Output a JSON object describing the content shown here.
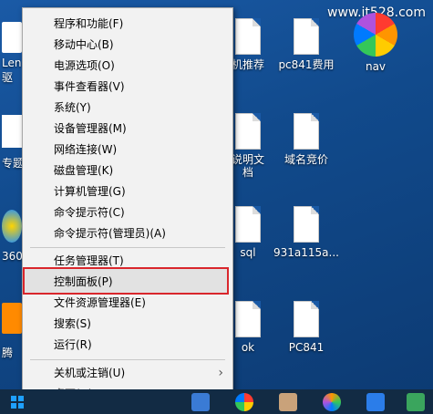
{
  "watermark": "www.it528.com",
  "desktop": {
    "icons": [
      {
        "label": "机推荐",
        "lines": [
          "机推荐"
        ]
      },
      {
        "label": "pc841费用",
        "lines": [
          "pc841费用"
        ]
      },
      {
        "label": "nav",
        "lines": [
          "nav"
        ]
      },
      {
        "label": "说明文档",
        "lines": [
          "说明文",
          "档"
        ]
      },
      {
        "label": "域名竞价",
        "lines": [
          "域名竞价"
        ]
      },
      {
        "label": "sql",
        "lines": [
          "sql"
        ]
      },
      {
        "label": "931a115a...",
        "lines": [
          "931a115a..."
        ]
      },
      {
        "label": "ok",
        "lines": [
          "ok"
        ]
      },
      {
        "label": "PC841",
        "lines": [
          "PC841"
        ]
      }
    ],
    "left_partial": [
      "Len",
      "驱",
      "专题",
      "360",
      "腾"
    ]
  },
  "menu": {
    "items": [
      {
        "label": "程序和功能(F)"
      },
      {
        "label": "移动中心(B)"
      },
      {
        "label": "电源选项(O)"
      },
      {
        "label": "事件查看器(V)"
      },
      {
        "label": "系统(Y)"
      },
      {
        "label": "设备管理器(M)"
      },
      {
        "label": "网络连接(W)"
      },
      {
        "label": "磁盘管理(K)"
      },
      {
        "label": "计算机管理(G)"
      },
      {
        "label": "命令提示符(C)"
      },
      {
        "label": "命令提示符(管理员)(A)"
      },
      {
        "label": "任务管理器(T)"
      },
      {
        "label": "控制面板(P)"
      },
      {
        "label": "文件资源管理器(E)"
      },
      {
        "label": "搜索(S)"
      },
      {
        "label": "运行(R)"
      },
      {
        "label": "关机或注销(U)"
      },
      {
        "label": "桌面(D)"
      }
    ],
    "submenu_arrow": "›",
    "highlight_color": "#d9262c"
  },
  "taskbar": {
    "start_icon": "windows-icon"
  }
}
